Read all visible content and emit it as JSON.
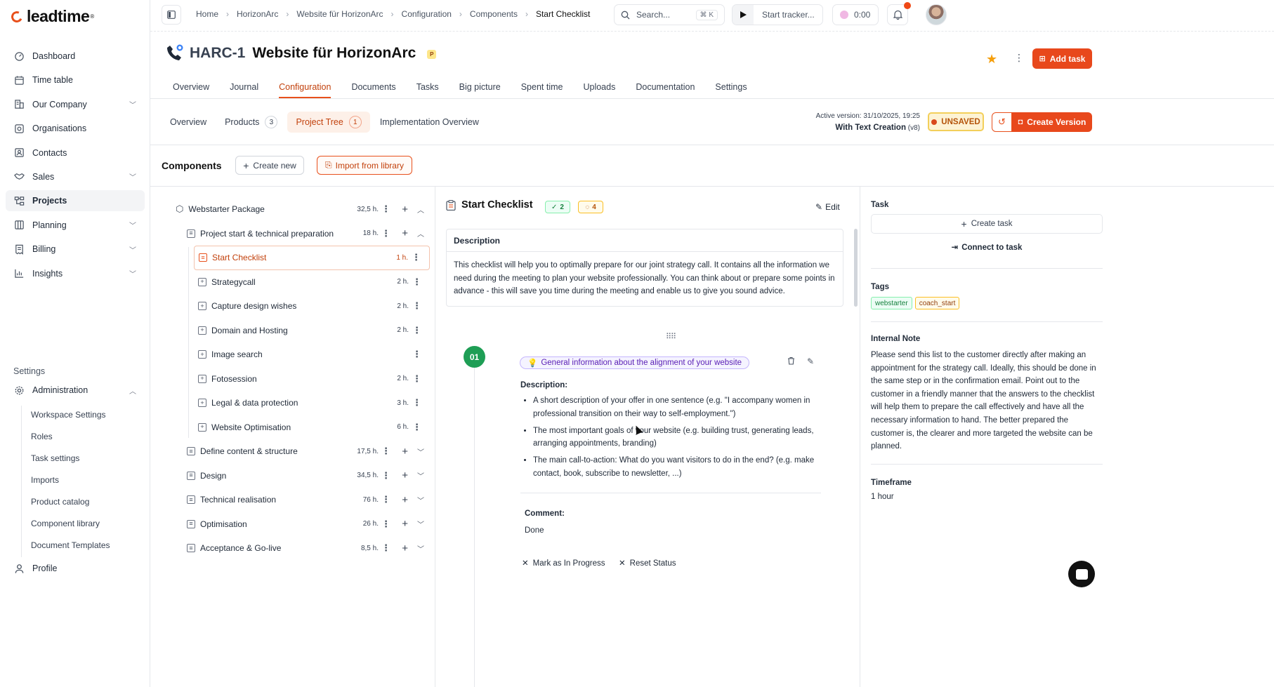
{
  "app": {
    "logo_text": "leadtime",
    "logo_reg": "®"
  },
  "sidebar": {
    "items": [
      {
        "label": "Dashboard",
        "icon": "gauge-icon"
      },
      {
        "label": "Time table",
        "icon": "calendar-icon"
      },
      {
        "label": "Our Company",
        "icon": "building-icon",
        "expandable": true
      },
      {
        "label": "Organisations",
        "icon": "org-icon"
      },
      {
        "label": "Contacts",
        "icon": "contact-card-icon"
      },
      {
        "label": "Sales",
        "icon": "handshake-icon",
        "expandable": true
      },
      {
        "label": "Projects",
        "icon": "project-tree-icon",
        "active": true
      },
      {
        "label": "Planning",
        "icon": "board-icon",
        "expandable": true
      },
      {
        "label": "Billing",
        "icon": "receipt-icon",
        "expandable": true
      },
      {
        "label": "Insights",
        "icon": "chart-icon",
        "expandable": true
      }
    ],
    "settings_label": "Settings",
    "administration": "Administration",
    "admin_items": [
      "Workspace Settings",
      "Roles",
      "Task settings",
      "Imports",
      "Product catalog",
      "Component library",
      "Document Templates"
    ],
    "profile": "Profile"
  },
  "topbar": {
    "breadcrumbs": [
      "Home",
      "HorizonArc",
      "Website für HorizonArc",
      "Configuration",
      "Components",
      "Start Checklist"
    ],
    "search_placeholder": "Search...",
    "search_shortcut": "⌘ K",
    "tracker_label": "Start tracker...",
    "timer": "0:00"
  },
  "project": {
    "code": "HARC-1",
    "name": "Website für HorizonArc",
    "badge": "P",
    "add_task": "Add task"
  },
  "tabs": [
    "Overview",
    "Journal",
    "Configuration",
    "Documents",
    "Tasks",
    "Big picture",
    "Spent time",
    "Uploads",
    "Documentation",
    "Settings"
  ],
  "active_tab": "Configuration",
  "subtabs": [
    {
      "label": "Overview"
    },
    {
      "label": "Products",
      "count": "3"
    },
    {
      "label": "Project Tree",
      "count": "1",
      "active": true
    },
    {
      "label": "Implementation Overview"
    }
  ],
  "version": {
    "active_line": "Active version: 31/10/2025, 19:25",
    "name": "With Text Creation",
    "num": "(v8)",
    "status": "UNSAVED",
    "create": "Create Version"
  },
  "components": {
    "title": "Components",
    "create_new": "Create new",
    "import": "Import from library"
  },
  "tree": [
    {
      "label": "Webstarter Package",
      "hours": "32,5 h.",
      "level": 0,
      "icon": "package-icon",
      "caret": "up"
    },
    {
      "label": "Project start & technical preparation",
      "hours": "18 h.",
      "level": 1,
      "icon": "list-icon",
      "caret": "up"
    },
    {
      "label": "Start Checklist",
      "hours": "1 h.",
      "level": 2,
      "selected": true
    },
    {
      "label": "Strategycall",
      "hours": "2 h.",
      "level": 2
    },
    {
      "label": "Capture design wishes",
      "hours": "2 h.",
      "level": 2
    },
    {
      "label": "Domain and Hosting",
      "hours": "2 h.",
      "level": 2
    },
    {
      "label": "Image search",
      "hours": "",
      "level": 2
    },
    {
      "label": "Fotosession",
      "hours": "2 h.",
      "level": 2
    },
    {
      "label": "Legal & data protection",
      "hours": "3 h.",
      "level": 2
    },
    {
      "label": "Website Optimisation",
      "hours": "6 h.",
      "level": 2
    },
    {
      "label": "Define content & structure",
      "hours": "17,5 h.",
      "level": 1,
      "caret": "down"
    },
    {
      "label": "Design",
      "hours": "34,5 h.",
      "level": 1,
      "caret": "down"
    },
    {
      "label": "Technical realisation",
      "hours": "76 h.",
      "level": 1,
      "caret": "down"
    },
    {
      "label": "Optimisation",
      "hours": "26 h.",
      "level": 1,
      "caret": "down"
    },
    {
      "label": "Acceptance & Go-live",
      "hours": "8,5 h.",
      "level": 1,
      "caret": "down"
    }
  ],
  "detail": {
    "title": "Start Checklist",
    "done_count": "2",
    "pending_count": "4",
    "edit": "Edit",
    "description_header": "Description",
    "description": "This checklist will help you to optimally prepare for our joint strategy call. It contains all the information we need during the meeting to plan your website professionally. You can think about or prepare some points in advance - this will save you time during the meeting and enable us to give you sound advice.",
    "step": {
      "number": "01",
      "title": "General information about the alignment of your website",
      "desc_label": "Description:",
      "bullets": [
        "A short description of your offer in one sentence (e.g. \"I accompany women in professional transition on their way to self-employment.\")",
        "The most important goals of your website (e.g. building trust, generating leads, arranging appointments, branding)",
        "The main call-to-action: What do you want visitors to do in the end? (e.g. make contact, book, subscribe to newsletter, ...)"
      ],
      "comment_label": "Comment:",
      "comment": "Done",
      "mark_progress": "Mark as In Progress",
      "reset": "Reset Status"
    }
  },
  "right": {
    "task_label": "Task",
    "create_task": "Create task",
    "connect": "Connect to task",
    "tags_label": "Tags",
    "tags": [
      "webstarter",
      "coach_start"
    ],
    "note_label": "Internal Note",
    "note": "Please send this list to the customer directly after making an appointment for the strategy call. Ideally, this should be done in the same step or in the confirmation email. Point out to the customer in a friendly manner that the answers to the checklist will help them to prepare the call effectively and have all the necessary information to hand. The better prepared the customer is, the clearer and more targeted the website can be planned.",
    "timeframe_label": "Timeframe",
    "timeframe": "1 hour"
  },
  "colors": {
    "accent": "#e8481c",
    "step_green": "#1e9e55"
  }
}
